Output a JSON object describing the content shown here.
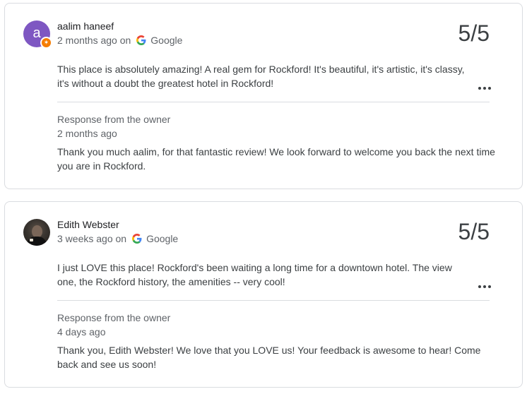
{
  "reviews": [
    {
      "reviewer_name": "aalim haneef",
      "avatar_letter": "a",
      "time_ago": "2 months ago on",
      "source": "Google",
      "score": "5/5",
      "text": "This place is absolutely amazing! A real gem for Rockford! It's beautiful, it's artistic, it's classy, it's without a doubt the greatest hotel in Rockford!",
      "response_title": "Response from the owner",
      "response_time": "2 months ago",
      "response_text": "Thank you much aalim, for that fantastic review! We look forward to welcome you back the next time you are in Rockford."
    },
    {
      "reviewer_name": "Edith Webster",
      "time_ago": "3 weeks ago on",
      "source": "Google",
      "score": "5/5",
      "text": "I just LOVE this place! Rockford's been waiting a long time for a downtown hotel. The view one, the Rockford history, the amenities -- very cool!",
      "response_title": "Response from the owner",
      "response_time": "4 days ago",
      "response_text": "Thank you, Edith Webster! We love that you LOVE us! Your feedback is awesome to hear! Come back and see us soon!"
    }
  ],
  "colors": {
    "avatar_purple": "#7e57c2",
    "badge_orange": "#f57c00",
    "border": "#dadce0",
    "text_primary": "#202124",
    "text_secondary": "#5f6368"
  },
  "icons": {
    "source_icon": "google-g-icon",
    "more_icon": "more-horizontal-icon",
    "badge_icon": "local-guide-badge-icon"
  }
}
